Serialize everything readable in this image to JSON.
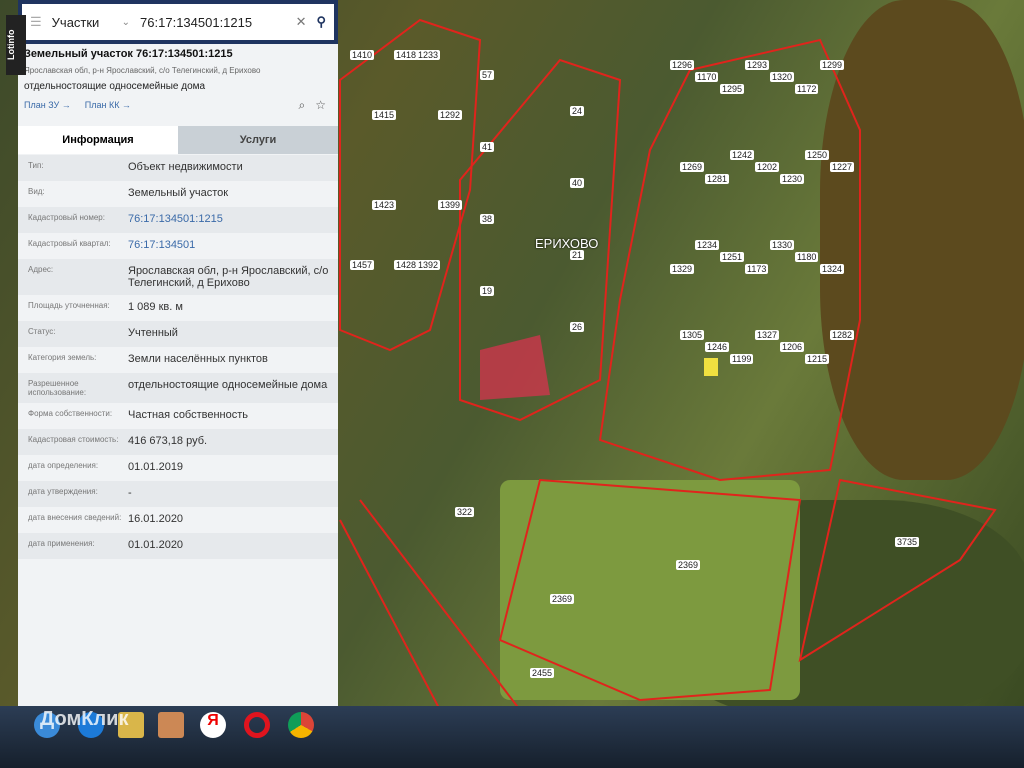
{
  "search": {
    "category": "Участки",
    "query": "76:17:134501:1215",
    "side_label": "Lotinfo"
  },
  "header": {
    "title": "Земельный участок 76:17:134501:1215",
    "address": "Ярославская обл, р-н Ярославский, с/о Телегинский, д Ерихово",
    "use": "отдельностоящие односемейные дома",
    "link_plan_zu": "План ЗУ →",
    "link_plan_kk": "План КК →"
  },
  "tabs": [
    {
      "label": "Информация"
    },
    {
      "label": "Услуги"
    }
  ],
  "info": [
    {
      "k": "Тип:",
      "v": "Объект недвижимости"
    },
    {
      "k": "Вид:",
      "v": "Земельный участок"
    },
    {
      "k": "Кадастровый номер:",
      "v": "76:17:134501:1215"
    },
    {
      "k": "Кадастровый квартал:",
      "v": "76:17:134501"
    },
    {
      "k": "Адрес:",
      "v": "Ярославская обл, р-н Ярославский, с/о Телегинский, д Ерихово"
    },
    {
      "k": "Площадь уточненная:",
      "v": "1 089 кв. м"
    },
    {
      "k": "Статус:",
      "v": "Учтенный"
    },
    {
      "k": "Категория земель:",
      "v": "Земли населённых пунктов"
    },
    {
      "k": "Разрешенное использование:",
      "v": "отдельностоящие односемейные дома"
    },
    {
      "k": "Форма собственности:",
      "v": "Частная собственность"
    },
    {
      "k": "Кадастровая стоимость:",
      "v": "416 673,18 руб."
    },
    {
      "k": "дата определения:",
      "v": "01.01.2019"
    },
    {
      "k": "дата утверждения:",
      "v": "-"
    },
    {
      "k": "дата внесения сведений:",
      "v": "16.01.2020"
    },
    {
      "k": "дата применения:",
      "v": "01.01.2020"
    }
  ],
  "map": {
    "village": "ЕРИХОВО",
    "parcels": [
      "1296",
      "1170",
      "1295",
      "1293",
      "1320",
      "1172",
      "1299",
      "1269",
      "1281",
      "1242",
      "1202",
      "1230",
      "1250",
      "1227",
      "1329",
      "1234",
      "1251",
      "1173",
      "1330",
      "1180",
      "1324",
      "1305",
      "1246",
      "1199",
      "1327",
      "1206",
      "1215",
      "1282",
      "1233",
      "1292",
      "1410",
      "1415",
      "1418",
      "1392",
      "1399",
      "1457",
      "1423",
      "1428",
      "57",
      "24",
      "41",
      "40",
      "38",
      "21",
      "19",
      "26",
      "322"
    ],
    "field_labels": [
      "2369",
      "2369",
      "2455",
      "3735"
    ]
  },
  "watermark": "ДомКлик"
}
